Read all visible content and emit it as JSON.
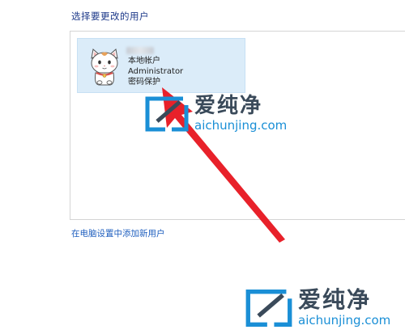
{
  "section_title": "选择要更改的用户",
  "account": {
    "type_label": "本地帐户",
    "name": "Administrator",
    "protection": "密码保护"
  },
  "add_user_link": "在电脑设置中添加新用户",
  "watermark": {
    "chinese": "爱纯净",
    "url": "aichunjing.com"
  },
  "colors": {
    "title": "#1e3a8a",
    "tile_bg": "#dbecf9",
    "link": "#1f5fbf",
    "arrow": "#e8212a",
    "watermark_blue": "#1a8fd6"
  }
}
